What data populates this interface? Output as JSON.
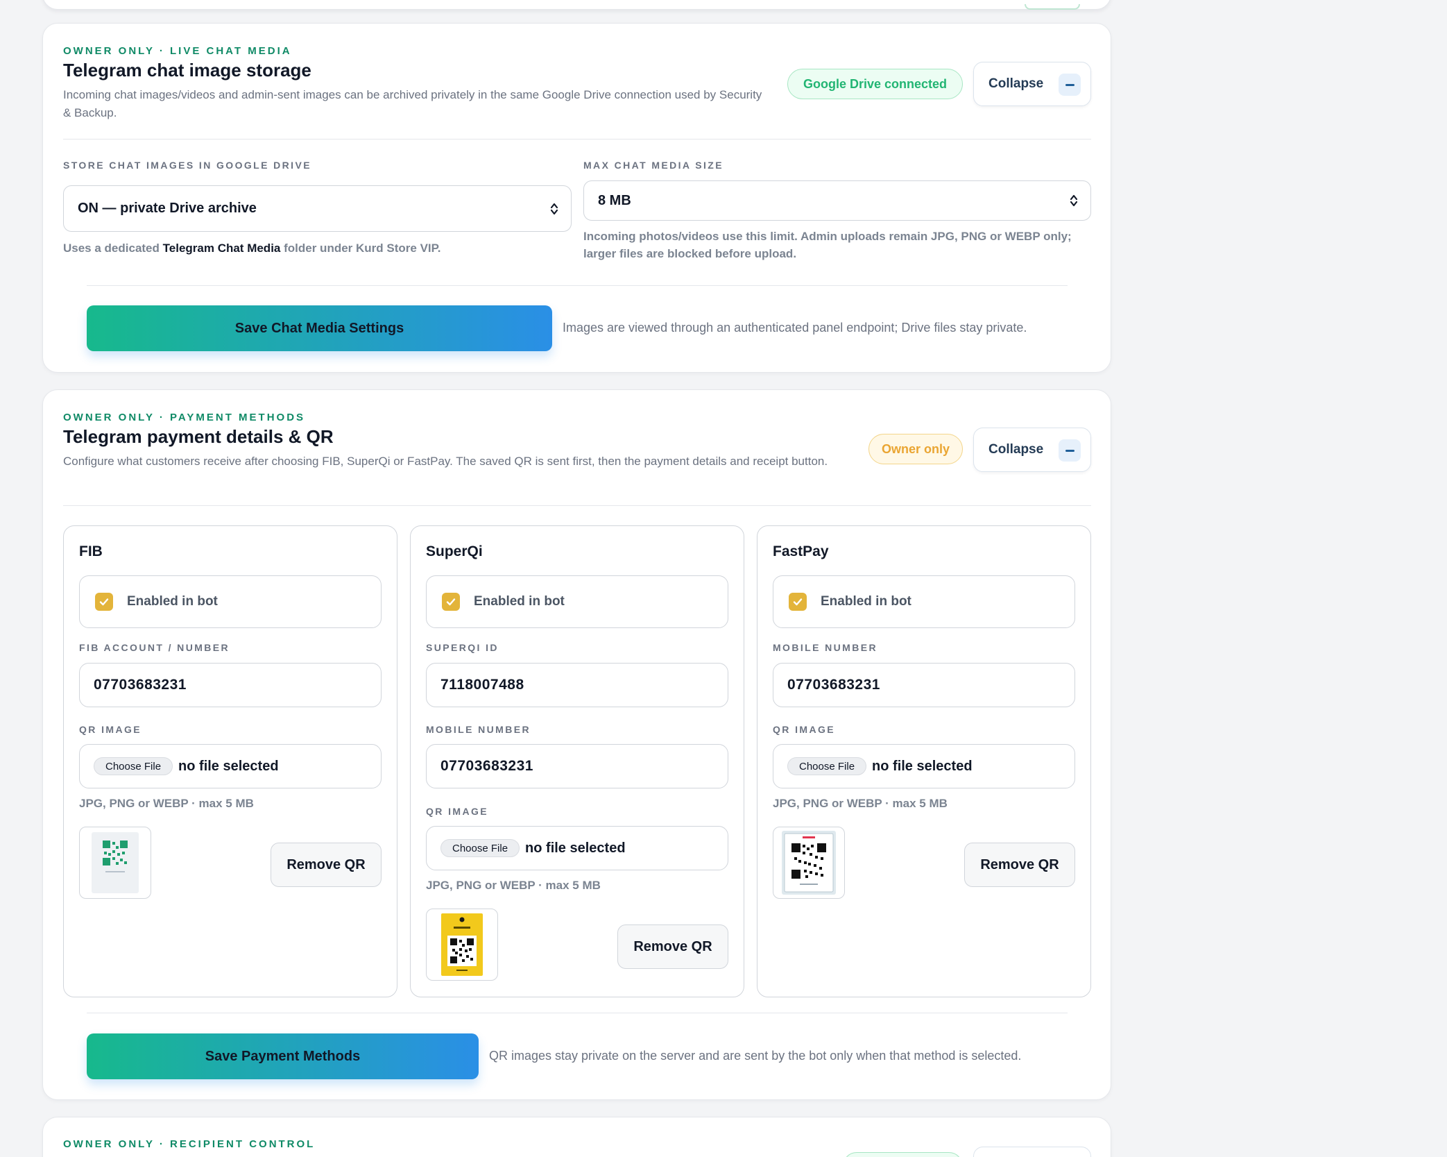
{
  "chat_media": {
    "eyebrow": "OWNER ONLY · LIVE CHAT MEDIA",
    "title": "Telegram chat image storage",
    "description": "Incoming chat images/videos and admin-sent images can be archived privately in the same Google Drive connection used by Security & Backup.",
    "status_badge": "Google Drive connected",
    "collapse_label": "Collapse",
    "store_label": "STORE CHAT IMAGES IN GOOGLE DRIVE",
    "store_value": "ON — private Drive archive",
    "store_hint_prefix": "Uses a dedicated",
    "store_hint_bold": "Telegram Chat Media",
    "store_hint_suffix": "folder under Kurd Store VIP.",
    "max_label": "MAX CHAT MEDIA SIZE",
    "max_value": "8 MB",
    "max_hint": "Incoming photos/videos use this limit. Admin uploads remain JPG, PNG or WEBP only; larger files are blocked before upload.",
    "save_label": "Save Chat Media Settings",
    "save_note": "Images are viewed through an authenticated panel endpoint; Drive files stay private."
  },
  "payment": {
    "eyebrow": "OWNER ONLY · PAYMENT METHODS",
    "title": "Telegram payment details & QR",
    "description": "Configure what customers receive after choosing FIB, SuperQi or FastPay. The saved QR is sent first, then the payment details and receipt button.",
    "status_badge": "Owner only",
    "collapse_label": "Collapse",
    "methods": [
      {
        "name": "FIB",
        "enabled_label": "Enabled in bot",
        "enabled": true,
        "field1_label": "FIB ACCOUNT / NUMBER",
        "field1_value": "07703683231",
        "qr_label": "QR IMAGE",
        "choose_file": "Choose File",
        "no_file": "no file selected",
        "file_hint": "JPG, PNG or WEBP · max 5 MB",
        "remove_label": "Remove QR"
      },
      {
        "name": "SuperQi",
        "enabled_label": "Enabled in bot",
        "enabled": true,
        "field1_label": "SUPERQI ID",
        "field1_value": "7118007488",
        "field2_label": "MOBILE NUMBER",
        "field2_value": "07703683231",
        "qr_label": "QR IMAGE",
        "choose_file": "Choose File",
        "no_file": "no file selected",
        "file_hint": "JPG, PNG or WEBP · max 5 MB",
        "remove_label": "Remove QR"
      },
      {
        "name": "FastPay",
        "enabled_label": "Enabled in bot",
        "enabled": true,
        "field1_label": "MOBILE NUMBER",
        "field1_value": "07703683231",
        "qr_label": "QR IMAGE",
        "choose_file": "Choose File",
        "no_file": "no file selected",
        "file_hint": "JPG, PNG or WEBP · max 5 MB",
        "remove_label": "Remove QR"
      }
    ],
    "save_label": "Save Payment Methods",
    "save_note": "QR images stay private on the server and are sent by the bot only when that method is selected."
  },
  "recipient": {
    "eyebrow": "OWNER ONLY · RECIPIENT CONTROL"
  },
  "colors": {
    "accent_green": "#0f8a66",
    "gradient_start": "#17b98c",
    "gradient_end": "#2a8fe6",
    "checkbox": "#e3b43a",
    "badge_green": "#22b573",
    "badge_amber": "#eaa532"
  }
}
